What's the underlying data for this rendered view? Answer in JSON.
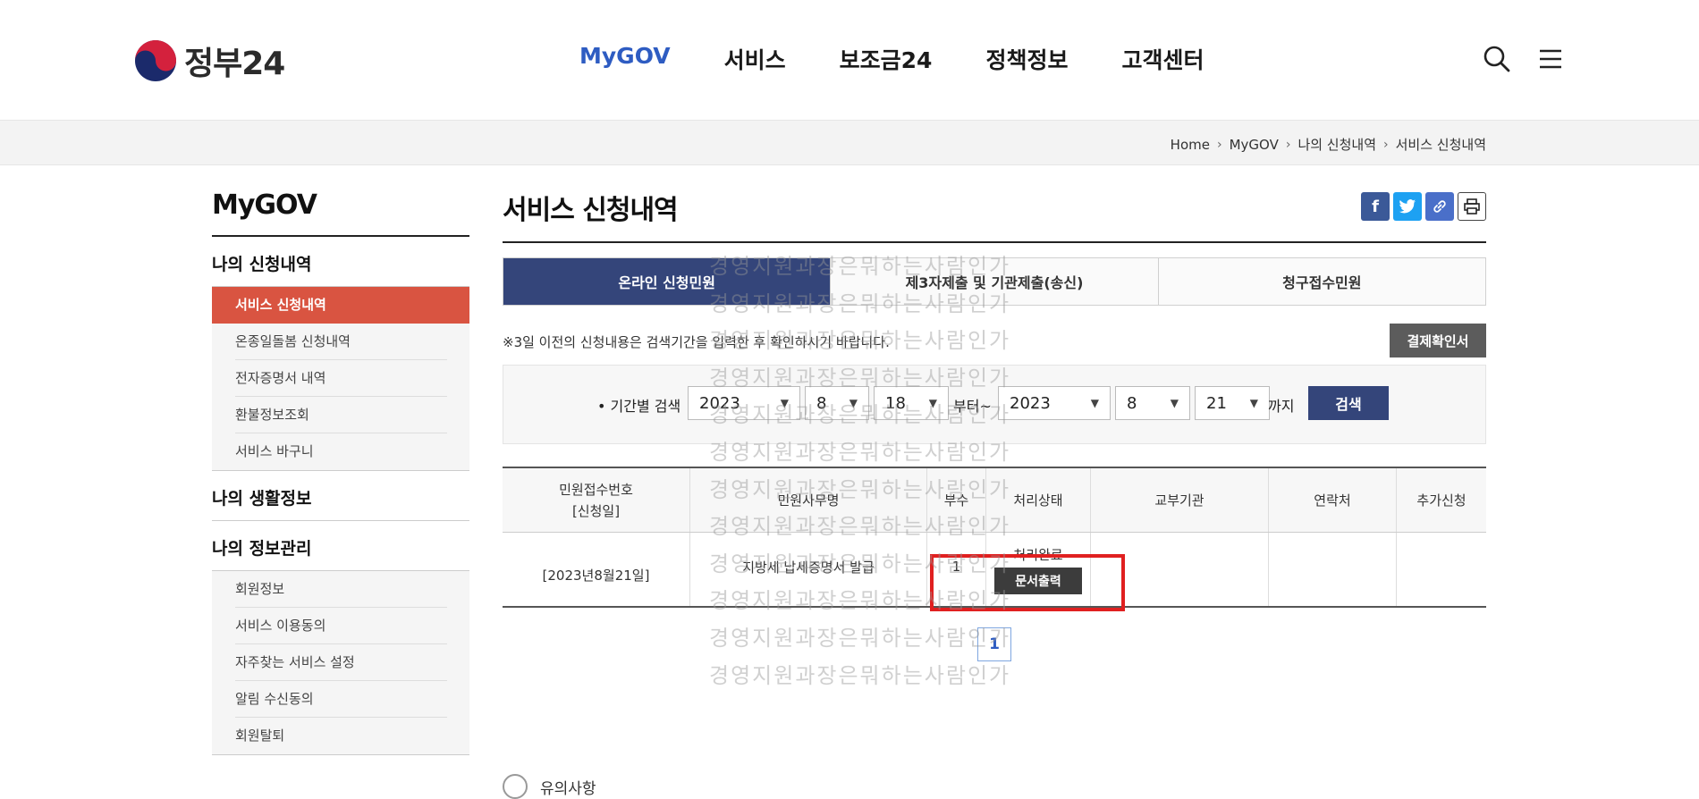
{
  "header": {
    "logo_text": "정부24",
    "nav": [
      "MyGOV",
      "서비스",
      "보조금24",
      "정책정보",
      "고객센터"
    ],
    "nav_active": "MyGOV",
    "icons": [
      "search-icon",
      "menu-icon"
    ]
  },
  "breadcrumb": [
    "Home",
    "MyGOV",
    "나의 신청내역",
    "서비스 신청내역"
  ],
  "sidebar": {
    "title": "MyGOV",
    "section1": "나의 신청내역",
    "section1_items": [
      "서비스 신청내역",
      "온종일돌봄 신청내역",
      "전자증명서 내역",
      "환불정보조회",
      "서비스 바구니"
    ],
    "section1_active": "서비스 신청내역",
    "section2": "나의 생활정보",
    "section3": "나의 정보관리",
    "section3_items": [
      "회원정보",
      "서비스 이용동의",
      "자주찾는 서비스 설정",
      "알림 수신동의",
      "회원탈퇴"
    ],
    "accent_color": "#d95441"
  },
  "main": {
    "title": "서비스 신청내역",
    "share_icons": [
      "facebook-icon",
      "twitter-icon",
      "link-icon",
      "print-icon"
    ],
    "tabs": [
      "온라인 신청민원",
      "제3자제출 및 기관제출(송신)",
      "청구접수민원"
    ],
    "tab_active": "온라인 신청민원",
    "notice": "※3일 이전의 신청내용은 검색기간을 입력한 후 확인하시기 바랍니다.",
    "receipt_button": "결제확인서",
    "search": {
      "label": "• 기간별 검색",
      "from_year": "2023",
      "from_month": "8",
      "from_day": "18",
      "from_suffix": "부터~",
      "to_year": "2023",
      "to_month": "8",
      "to_day": "21",
      "to_suffix": "까지",
      "button": "검색"
    },
    "table": {
      "headers": [
        "민원접수번호",
        "[신청일]",
        "민원사무명",
        "부수",
        "처리상태",
        "교부기관",
        "연락처",
        "추가신청"
      ],
      "row": {
        "date": "[2023년8월21일]",
        "name": "지방세 납세증명서 발급",
        "count": "1",
        "status": "처리완료",
        "print_button": "문서출력"
      }
    },
    "pagination": "1",
    "bottom_peek": "유의사항"
  },
  "watermark": {
    "text": "경영지원과장은뭐하는사람인가",
    "lines": [
      "경영지원과장은뭐하는사람인가",
      "경영지원과장은뭐하는사람인가",
      "경영지원과장은뭐하는사람인가",
      "경영지원과장은뭐하는사람인가",
      "경영지원과장은뭐하는사람인가",
      "경영지원과장은뭐하는사람인가",
      "경영지원과장은뭐하는사람인가",
      "경영지원과장은뭐하는사람인가",
      "경영지원과장은뭐하는사람인가",
      "경영지원과장은뭐하는사람인가",
      "경영지원과장은뭐하는사람인가",
      "경영지원과장은뭐하는사람인가"
    ]
  }
}
